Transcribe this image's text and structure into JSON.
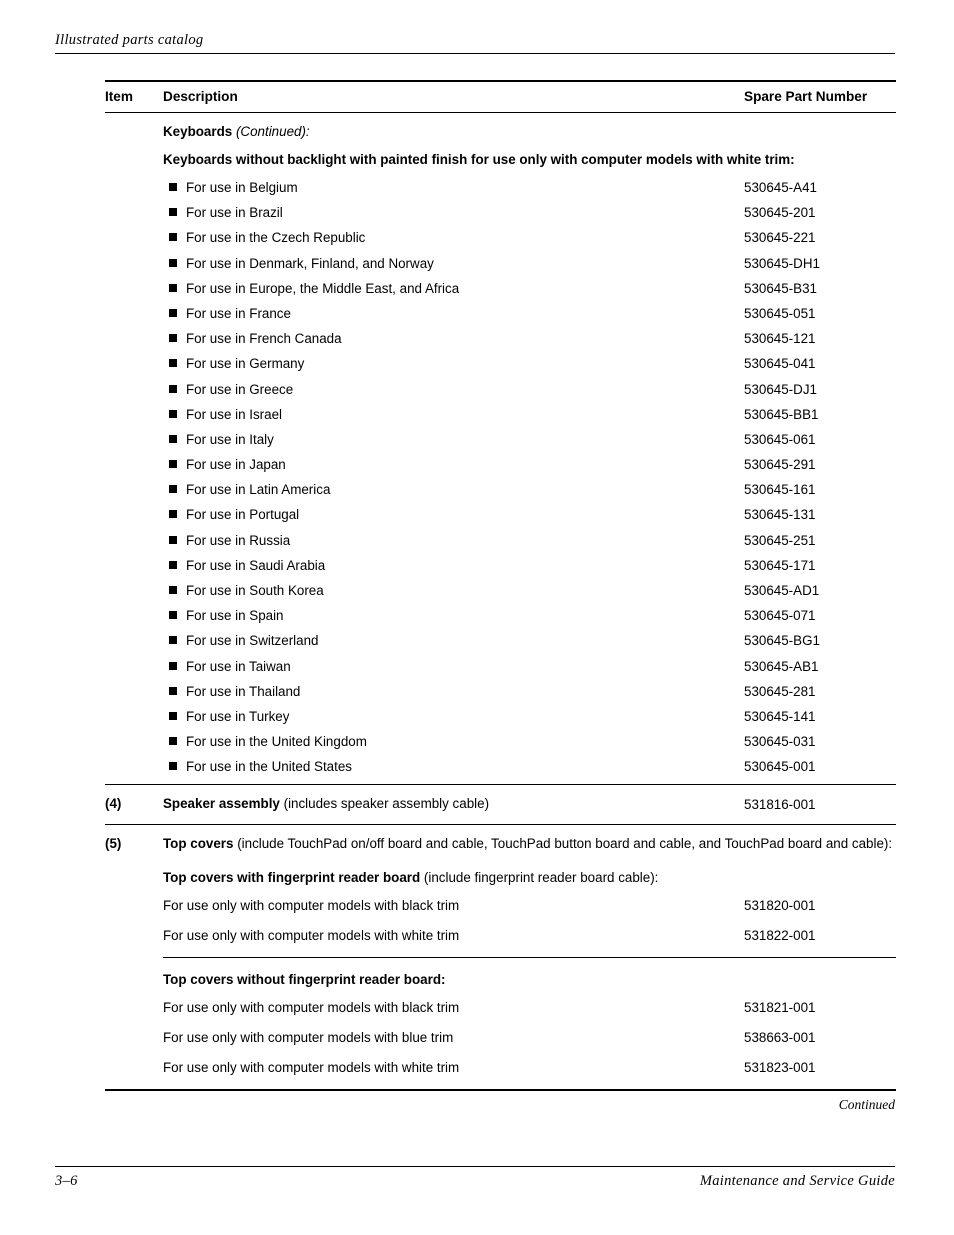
{
  "header": {
    "running_title": "Illustrated parts catalog"
  },
  "table": {
    "columns": {
      "item": "Item",
      "description": "Description",
      "spare_part_number": "Spare Part Number"
    },
    "section_heading": {
      "bold": "Keyboards",
      "italic": "(Continued):"
    },
    "subsection_heading": "Keyboards without backlight with painted finish for use only with computer models with white trim:",
    "keyboard_rows": [
      {
        "description": "For use in Belgium",
        "part": "530645-A41"
      },
      {
        "description": "For use in Brazil",
        "part": "530645-201"
      },
      {
        "description": "For use in the Czech Republic",
        "part": "530645-221"
      },
      {
        "description": "For use in Denmark, Finland, and Norway",
        "part": "530645-DH1"
      },
      {
        "description": "For use in Europe, the Middle East, and Africa",
        "part": "530645-B31"
      },
      {
        "description": "For use in France",
        "part": "530645-051"
      },
      {
        "description": "For use in French Canada",
        "part": "530645-121"
      },
      {
        "description": "For use in Germany",
        "part": "530645-041"
      },
      {
        "description": "For use in Greece",
        "part": "530645-DJ1"
      },
      {
        "description": "For use in Israel",
        "part": "530645-BB1"
      },
      {
        "description": "For use in Italy",
        "part": "530645-061"
      },
      {
        "description": "For use in Japan",
        "part": "530645-291"
      },
      {
        "description": "For use in Latin America",
        "part": "530645-161"
      },
      {
        "description": "For use in Portugal",
        "part": "530645-131"
      },
      {
        "description": "For use in Russia",
        "part": "530645-251"
      },
      {
        "description": "For use in Saudi Arabia",
        "part": "530645-171"
      },
      {
        "description": "For use in South Korea",
        "part": "530645-AD1"
      },
      {
        "description": "For use in Spain",
        "part": "530645-071"
      },
      {
        "description": "For use in Switzerland",
        "part": "530645-BG1"
      },
      {
        "description": "For use in Taiwan",
        "part": "530645-AB1"
      },
      {
        "description": "For use in Thailand",
        "part": "530645-281"
      },
      {
        "description": "For use in Turkey",
        "part": "530645-141"
      },
      {
        "description": "For use in the United Kingdom",
        "part": "530645-031"
      },
      {
        "description": "For use in the United States",
        "part": "530645-001"
      }
    ],
    "speaker_assembly": {
      "item": "(4)",
      "bold": "Speaker assembly",
      "rest": "(includes speaker assembly cable)",
      "part": "531816-001"
    },
    "top_covers": {
      "item": "(5)",
      "bold": "Top covers",
      "rest": "(include TouchPad on/off board and cable, TouchPad button board and cable, and TouchPad board and cable):",
      "with_fpr_heading_bold": "Top covers with fingerprint reader board",
      "with_fpr_heading_rest": "(include fingerprint reader board cable):",
      "with_fpr_rows": [
        {
          "description": "For use only with computer models with black trim",
          "part": "531820-001"
        },
        {
          "description": "For use only with computer models with white trim",
          "part": "531822-001"
        }
      ],
      "without_fpr_heading": "Top covers without fingerprint reader board:",
      "without_fpr_rows": [
        {
          "description": "For use only with computer models with black trim",
          "part": "531821-001"
        },
        {
          "description": "For use only with computer models with blue trim",
          "part": "538663-001"
        },
        {
          "description": "For use only with computer models with white trim",
          "part": "531823-001"
        }
      ]
    },
    "continued_note": "Continued"
  },
  "footer": {
    "page_number": "3–6",
    "guide_title": "Maintenance and Service Guide"
  }
}
